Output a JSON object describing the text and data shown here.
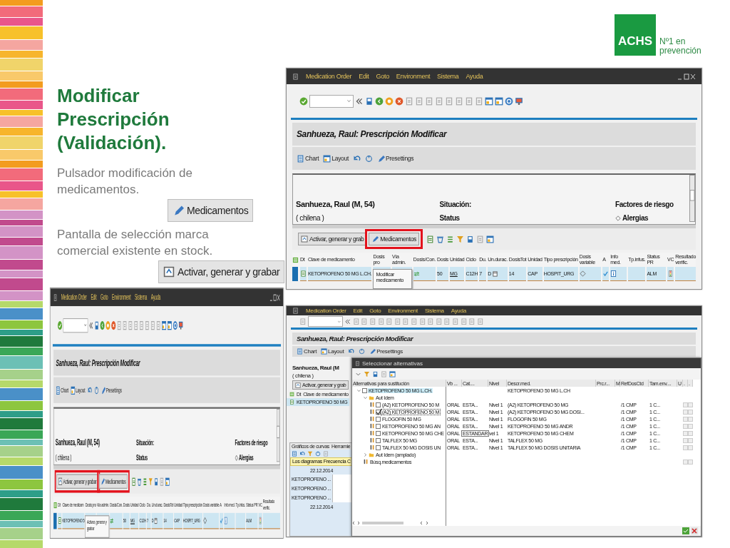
{
  "slide": {
    "title": "Modificar Prescripción (Validación).",
    "notes": [
      {
        "text": "Pulsador  modificación de medicamentos.",
        "sample_button": {
          "label": "Medicamentos",
          "kind": "pencil"
        }
      },
      {
        "text": "Pantalla de selección marca comercial existente en stock.",
        "sample_button": {
          "label": "Activar, generar y grabar",
          "kind": "activate"
        }
      }
    ]
  },
  "logo": {
    "mark": "ACHS",
    "tagline": [
      "Nº1 en",
      "prevención"
    ]
  },
  "screens": [
    {
      "menu": [
        "Medication Order",
        "Edit",
        "Goto",
        "Environment",
        "Sistema",
        "Ayuda"
      ],
      "window_controls": true,
      "heading": "Sanhueza, Raul: Prescripción Modificar",
      "view_tools": [
        {
          "kind": "chart",
          "label": "Chart"
        },
        {
          "kind": "layout",
          "label": "Layout"
        },
        {
          "kind": "undo"
        },
        {
          "kind": "refresh"
        },
        {
          "kind": "pencil",
          "label": "Presettings"
        }
      ],
      "patient": {
        "name": "Sanhueza, Raul (M, 54)",
        "nationality": "( chilena )",
        "situation": "Situación:",
        "status": "Status",
        "risk": "Factores de riesgo",
        "allergies": "Alergias"
      },
      "actions": [
        {
          "kind": "activate",
          "label": "Activar, generar y grab",
          "highlighted": false
        },
        {
          "kind": "pencil",
          "label": "Medicamentos",
          "highlighted": true,
          "tooltip": "Modificar medicamento"
        }
      ],
      "table": {
        "columns": [
          "Dt",
          "Clave de medicamento",
          "Dosis pro",
          "Vía admin.",
          "Dosis/Con.",
          "Dosis",
          "Unidad",
          "Ciclo",
          "Du.",
          "Un.durac.",
          "DosisTot",
          "Unidad",
          "Tipo prescripción",
          "Dosis variable",
          "A",
          "Info med.",
          "Tp.infus.",
          "Status PR",
          "VC",
          "Resultado verific."
        ],
        "rows": [
          {
            "selected": true,
            "cells": [
              {
                "kind": "doc"
              },
              {
                "kind": "text",
                "text": "KETOPROFENO 50 MG L.CH."
              },
              {
                "kind": "blank"
              },
              {
                "kind": "blank"
              },
              {
                "kind": "arrows"
              },
              {
                "kind": "text",
                "text": "50"
              },
              {
                "kind": "link",
                "text": "MG"
              },
              {
                "kind": "text",
                "text": "C12H"
              },
              {
                "kind": "text",
                "text": "7"
              },
              {
                "kind": "text_calendar",
                "text": "D"
              },
              {
                "kind": "text",
                "text": "14"
              },
              {
                "kind": "text",
                "text": "CAP"
              },
              {
                "kind": "text",
                "text": "HOSPIT_URG"
              },
              {
                "kind": "diamond"
              },
              {
                "kind": "check"
              },
              {
                "kind": "info"
              },
              {
                "kind": "blank"
              },
              {
                "kind": "text",
                "text": "ALM"
              },
              {
                "kind": "traffic"
              },
              {
                "kind": "blank"
              }
            ]
          }
        ]
      }
    },
    {
      "menu": [
        "Medication Order",
        "Edit",
        "Goto",
        "Environment",
        "Sistema",
        "Ayuda"
      ],
      "window_controls": true,
      "heading": "Sanhueza, Raul: Prescripción Modificar",
      "view_tools": [
        {
          "kind": "chart",
          "label": "Chart"
        },
        {
          "kind": "layout",
          "label": "Layout"
        },
        {
          "kind": "undo"
        },
        {
          "kind": "refresh"
        },
        {
          "kind": "pencil",
          "label": "Presettings"
        }
      ],
      "patient": {
        "name": "Sanhueza, Raul (M, 54)",
        "nationality": "( chilena )",
        "situation": "Situación:",
        "status": "Status",
        "risk": "Factores de riesgo",
        "allergies": "Alergias"
      },
      "actions": [
        {
          "kind": "activate",
          "label": "Activar, generar y grabar",
          "highlighted": true,
          "tooltip": "Activar, generar y grabar"
        },
        {
          "kind": "pencil",
          "label": "Medicamentos",
          "highlighted": true
        }
      ],
      "table": {
        "columns": [
          "Dt",
          "Clave de medicam",
          "Dosis pro",
          "Vía admin.",
          "Dosis/Con.",
          "Dosis",
          "Unidad",
          "Ciclo",
          "Du.",
          "Un.durac.",
          "DosisTot",
          "Unidad",
          "Tipo prescripción",
          "Dosis variable",
          "A",
          "Info med.",
          "Tp.infus.",
          "Status PR",
          "VC",
          "Resultado verific."
        ],
        "rows": [
          {
            "selected": true,
            "cells": [
              {
                "kind": "doc"
              },
              {
                "kind": "text",
                "text": "KETOPROFENO 5"
              },
              {
                "kind": "blank"
              },
              {
                "kind": "blank"
              },
              {
                "kind": "arrows"
              },
              {
                "kind": "text",
                "text": "50"
              },
              {
                "kind": "link",
                "text": "MG"
              },
              {
                "kind": "text",
                "text": "C12H"
              },
              {
                "kind": "text",
                "text": "7"
              },
              {
                "kind": "text_calendar",
                "text": "D"
              },
              {
                "kind": "text",
                "text": "14"
              },
              {
                "kind": "text",
                "text": "CAP"
              },
              {
                "kind": "text",
                "text": "HOSPIT_URG"
              },
              {
                "kind": "diamond"
              },
              {
                "kind": "check"
              },
              {
                "kind": "info"
              },
              {
                "kind": "blank"
              },
              {
                "kind": "text",
                "text": "ALM"
              },
              {
                "kind": "traffic"
              },
              {
                "kind": "blank"
              }
            ]
          }
        ]
      }
    }
  ],
  "selection_screen": {
    "menu": [
      "Medication Order",
      "Edit",
      "Goto",
      "Environment",
      "Sistema",
      "Ayuda"
    ],
    "toolbar_disabled": true,
    "heading": "Sanhueza, Raul: Prescripción Modificar",
    "view_tools": [
      {
        "kind": "chart",
        "label": "Chart"
      },
      {
        "kind": "layout",
        "label": "Layout"
      },
      {
        "kind": "undo"
      },
      {
        "kind": "refresh"
      },
      {
        "kind": "pencil",
        "label": "Presettings"
      }
    ],
    "patient": {
      "name": "Sanhueza, Raul (M",
      "nationality": "( chilena )"
    },
    "action": "Activar, generar y grab",
    "table_head": [
      "Dt",
      "Clave de medicamento"
    ],
    "table_row": "KETOPROFENO 50 MG",
    "curves": {
      "tabs": [
        "Gráficos de curvas",
        "Herramie"
      ],
      "notice": "Los diagramas Frecuencia C",
      "dates": [
        "22.12.2014",
        "22.12.2014"
      ],
      "series": [
        "KETOPROFENO ...",
        "KETOPROFENO ...",
        "KETOPROFENO ..."
      ]
    },
    "dialog": {
      "title": "Seleccionar alternativas",
      "tree_header": "Alternativas para sustitución",
      "columns": [
        "Vb ...",
        "Cat....",
        "Nivel",
        "Descr.med.",
        "Prc.r...",
        "M",
        "RefDosCtd",
        "Tam.env....",
        "U",
        ".",
        "."
      ],
      "tree": [
        {
          "kind": "material",
          "label": "KETOPROFENO 50 MG L.CH.",
          "selected": true,
          "checked": false,
          "expanded": true,
          "flag_boxes": false,
          "values": {
            "descr": "KETOPROFENO 50 MG L.CH"
          },
          "children": [
            {
              "kind": "folder",
              "label": "Aut Idem",
              "expanded": true,
              "children": [
                {
                  "kind": "alternative",
                  "label": "(A2) KETOPROFENO 50 M",
                  "checked": false,
                  "focused": false,
                  "editing": false,
                  "flag_boxes": true,
                  "values": {
                    "vb": "ORAL",
                    "cat": "ESTA...",
                    "nivel": "Nivel 1",
                    "descr": "(A2) KETOPROFENO 50 MG",
                    "ref": "/1 CMP",
                    "tam": "1 C..."
                  }
                },
                {
                  "kind": "alternative",
                  "label": "(A2) KETOPROFENO 50 M",
                  "checked": true,
                  "focused": true,
                  "editing": false,
                  "flag_boxes": true,
                  "values": {
                    "vb": "ORAL",
                    "cat": "ESTA...",
                    "nivel": "Nivel 1",
                    "descr": "(A2) KETOPROFENO 50 MG DOSI...",
                    "ref": "/1 CMP",
                    "tam": "1 C..."
                  }
                },
                {
                  "kind": "alternative",
                  "label": "FLOGOFIN 50 MG",
                  "checked": false,
                  "focused": false,
                  "editing": false,
                  "flag_boxes": true,
                  "values": {
                    "vb": "ORAL",
                    "cat": "ESTA...",
                    "nivel": "Nivel 1",
                    "descr": "FLOGOFIN 50 MG",
                    "ref": "/1 CMP",
                    "tam": "1 C..."
                  }
                },
                {
                  "kind": "alternative",
                  "label": "KETOPROFENO 50 MG AN",
                  "checked": false,
                  "focused": false,
                  "editing": false,
                  "flag_boxes": true,
                  "values": {
                    "vb": "ORAL",
                    "cat": "ESTA...",
                    "nivel": "Nivel 1",
                    "descr": "KETOPROFENO 50 MG ANDR",
                    "ref": "/1 CMP",
                    "tam": "1 C..."
                  }
                },
                {
                  "kind": "alternative",
                  "label": "KETOPROFENO 50 MG CHE",
                  "checked": false,
                  "focused": false,
                  "editing": true,
                  "flag_boxes": true,
                  "values": {
                    "vb": "ORAL",
                    "cat": "ESTANDAR",
                    "nivel": "vel 1",
                    "descr": "KETOPROFENO 50 MG CHEM",
                    "ref": "/1 CMP",
                    "tam": "1 C..."
                  }
                },
                {
                  "kind": "alternative",
                  "label": "TALFLEX 50 MG",
                  "checked": false,
                  "focused": false,
                  "editing": false,
                  "flag_boxes": true,
                  "values": {
                    "vb": "ORAL",
                    "cat": "ESTA...",
                    "nivel": "Nivel 1",
                    "descr": "TALFLEX 50 MG",
                    "ref": "/1 CMP",
                    "tam": "1 C..."
                  }
                },
                {
                  "kind": "alternative",
                  "label": "TALFLEX 50 MG DOSIS UN",
                  "checked": false,
                  "focused": false,
                  "editing": false,
                  "flag_boxes": true,
                  "values": {
                    "vb": "ORAL",
                    "cat": "ESTA...",
                    "nivel": "Nivel 1",
                    "descr": "TALFLEX 50 MG DOSIS UNITARIA",
                    "ref": "/1 CMP",
                    "tam": "1 C..."
                  }
                }
              ]
            },
            {
              "kind": "folder",
              "label": "Aut Idem (amplado)",
              "expanded": false
            },
            {
              "kind": "search",
              "label": "Búsq.medicamentos",
              "flag_boxes": true
            }
          ]
        }
      ]
    }
  }
}
